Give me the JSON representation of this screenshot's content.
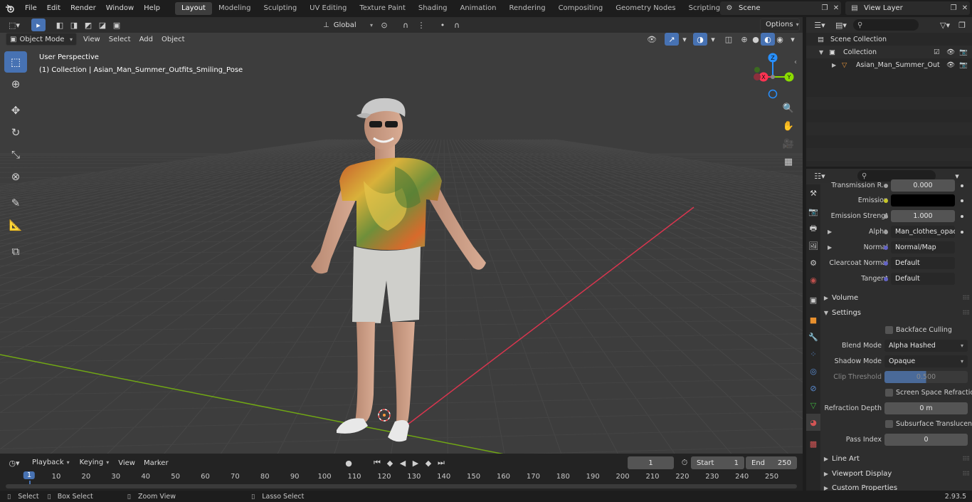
{
  "top_menu": {
    "items": [
      "File",
      "Edit",
      "Render",
      "Window",
      "Help"
    ],
    "workspaces": [
      "Layout",
      "Modeling",
      "Sculpting",
      "UV Editing",
      "Texture Paint",
      "Shading",
      "Animation",
      "Rendering",
      "Compositing",
      "Geometry Nodes",
      "Scripting"
    ],
    "active_workspace": "Layout",
    "scene": "Scene",
    "view_layer": "View Layer"
  },
  "viewport": {
    "mode": "Object Mode",
    "menus": [
      "View",
      "Select",
      "Add",
      "Object"
    ],
    "orientation": "Global",
    "options_label": "Options",
    "view_name": "User Perspective",
    "object_info": "(1) Collection | Asian_Man_Summer_Outfits_Smiling_Pose",
    "gizmo": {
      "x": "X",
      "y": "Y",
      "z": "Z"
    }
  },
  "outliner": {
    "scene_collection": "Scene Collection",
    "collection": "Collection",
    "object": "Asian_Man_Summer_Out"
  },
  "properties": {
    "rows": {
      "transmission_label": "Transmission R...",
      "transmission_value": "0.000",
      "emission_label": "Emission",
      "emission_strength_label": "Emission Strengt",
      "emission_strength_value": "1.000",
      "alpha_label": "Alpha",
      "alpha_value": "Man_clothes_opacit...",
      "normal_label": "Normal",
      "normal_value": "Normal/Map",
      "clearcoat_normal_label": "Clearcoat Normal",
      "clearcoat_normal_value": "Default",
      "tangent_label": "Tangent",
      "tangent_value": "Default"
    },
    "sections": {
      "volume": "Volume",
      "settings": "Settings",
      "line_art": "Line Art",
      "viewport_display": "Viewport Display",
      "custom_properties": "Custom Properties"
    },
    "settings": {
      "backface_culling": "Backface Culling",
      "blend_mode_label": "Blend Mode",
      "blend_mode_value": "Alpha Hashed",
      "shadow_mode_label": "Shadow Mode",
      "shadow_mode_value": "Opaque",
      "clip_threshold_label": "Clip Threshold",
      "clip_threshold_value": "0.500",
      "screen_space_refraction": "Screen Space Refraction",
      "refraction_depth_label": "Refraction Depth",
      "refraction_depth_value": "0 m",
      "subsurface_translucency": "Subsurface Translucency",
      "pass_index_label": "Pass Index",
      "pass_index_value": "0"
    }
  },
  "timeline": {
    "menus": [
      "Playback",
      "Keying",
      "View",
      "Marker"
    ],
    "current_frame": "1",
    "start_label": "Start",
    "start_value": "1",
    "end_label": "End",
    "end_value": "250",
    "ruler_labels": [
      "1",
      "10",
      "20",
      "30",
      "40",
      "50",
      "60",
      "70",
      "80",
      "90",
      "100",
      "110",
      "120",
      "130",
      "140",
      "150",
      "160",
      "170",
      "180",
      "190",
      "200",
      "210",
      "220",
      "230",
      "240",
      "250"
    ]
  },
  "statusbar": {
    "select": "Select",
    "box_select": "Box Select",
    "zoom_view": "Zoom View",
    "lasso_select": "Lasso Select",
    "version": "2.93.5"
  },
  "colors": {
    "accent": "#4772b3",
    "x_axis": "#ff3352",
    "y_axis": "#8bdc00",
    "z_axis": "#2890ff"
  }
}
